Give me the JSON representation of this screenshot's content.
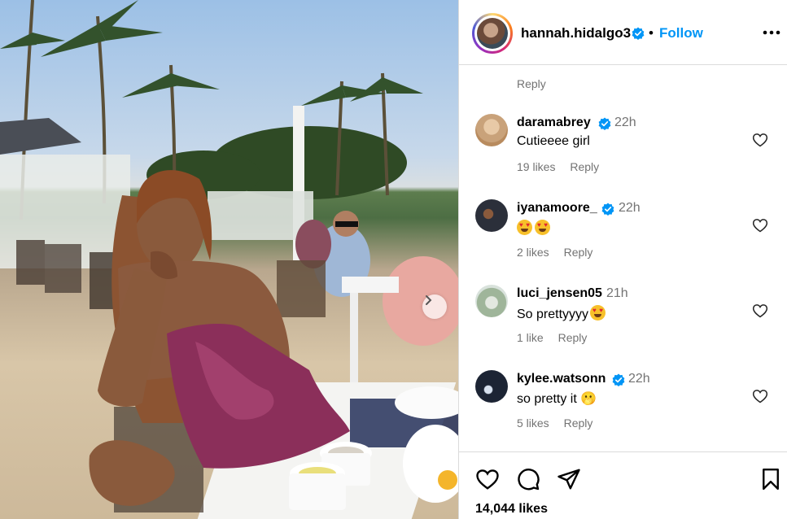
{
  "post": {
    "username": "hannah.hidalgo3",
    "follow_label": "Follow",
    "separator": "•",
    "more_icon": "more-horizontal-icon",
    "likes_text": "14,044 likes"
  },
  "top_reply_label": "Reply",
  "comments": [
    {
      "username": "daramabrey",
      "verified": true,
      "time": "22h",
      "text": "Cutieeee girl",
      "likes": "19 likes",
      "reply": "Reply",
      "avatar_color": "#c9a27a"
    },
    {
      "username": "iyanamoore_",
      "verified": true,
      "time": "22h",
      "text": "",
      "likes": "2 likes",
      "reply": "Reply",
      "avatar_color": "#2b2f3a"
    },
    {
      "username": "luci_jensen05",
      "verified": false,
      "time": "21h",
      "text": "So prettyyyy",
      "likes": "1 like",
      "reply": "Reply",
      "avatar_color": "#9fb59a"
    },
    {
      "username": "kylee.watsonn",
      "verified": true,
      "time": "22h",
      "text": "so pretty it 🫢",
      "likes": "5 likes",
      "reply": "Reply",
      "avatar_color": "#1c2434"
    }
  ],
  "colors": {
    "link": "#0095f6",
    "verified": "#0095f6",
    "muted": "#737373",
    "border": "#dbdbdb"
  }
}
